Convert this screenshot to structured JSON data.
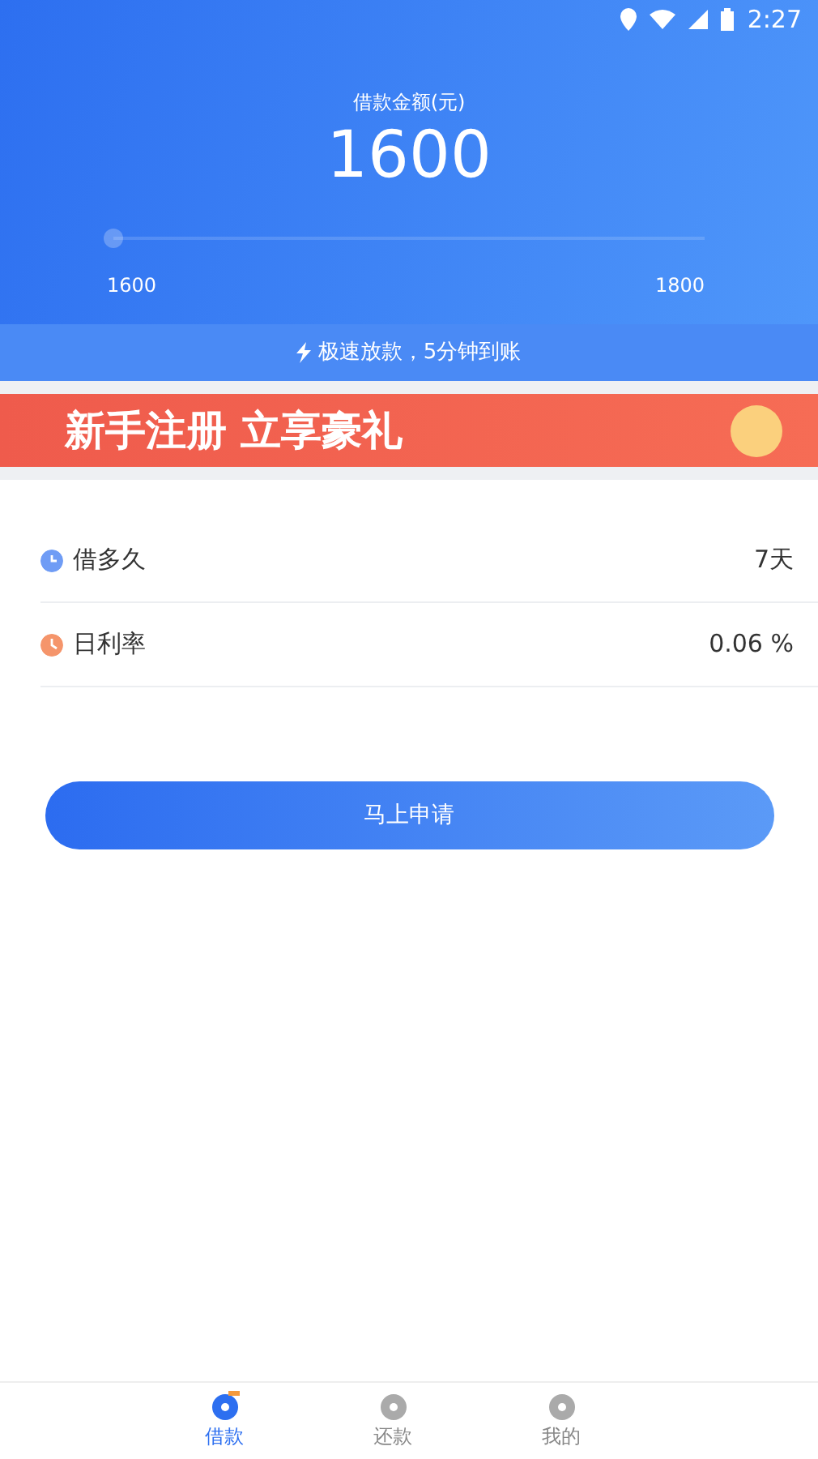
{
  "status_bar": {
    "time": "2:27"
  },
  "amount": {
    "label": "借款金额(元)",
    "value": "1600"
  },
  "slider": {
    "level": 0,
    "min_label": "1600",
    "max_label": "1800"
  },
  "notice": "极速放款，5分钟到账",
  "banner": {
    "title": "新手注册 立享豪礼"
  },
  "details": [
    {
      "kind": "clock",
      "label": "借多久",
      "value": "7天",
      "color": "#6f9cf5"
    },
    {
      "kind": "rate",
      "label": "日利率",
      "value": "0.06 %",
      "color": "#f5956b"
    }
  ],
  "apply_button": "马上申请",
  "tabs": [
    {
      "label": "借款",
      "selected": true
    },
    {
      "label": "还款",
      "selected": false
    },
    {
      "label": "我的",
      "selected": false
    }
  ]
}
